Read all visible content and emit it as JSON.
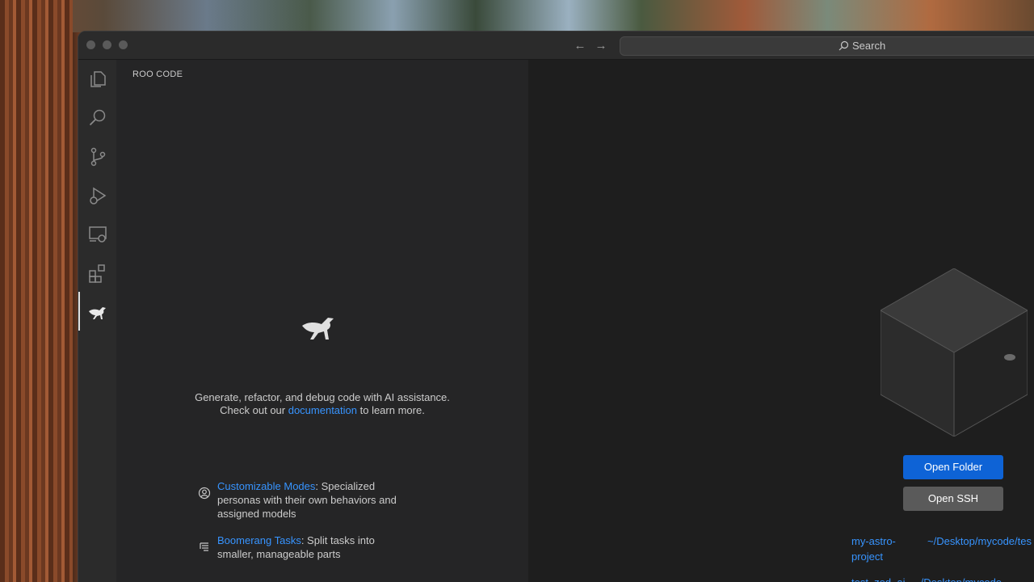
{
  "titlebar": {
    "search_placeholder": "Search"
  },
  "sidebar": {
    "title": "ROO CODE",
    "intro_line1": "Generate, refactor, and debug code with AI assistance.",
    "intro_prefix": "Check out our ",
    "intro_link": "documentation",
    "intro_suffix": " to learn more.",
    "features": [
      {
        "link": "Customizable Modes",
        "text": ": Specialized personas with their own behaviors and assigned models"
      },
      {
        "link": "Boomerang Tasks",
        "text": ": Split tasks into smaller, manageable parts"
      }
    ]
  },
  "editor": {
    "open_folder": "Open Folder",
    "open_ssh": "Open SSH",
    "recent": [
      {
        "name": "my-astro-project",
        "path": "~/Desktop/mycode/tes"
      },
      {
        "name": "test_zed_ai",
        "path": "~/Desktop/mycode"
      }
    ]
  },
  "colors": {
    "accent": "#3794ff",
    "primary_button": "#0e63d6",
    "sidebar_bg": "#252526",
    "editor_bg": "#1e1e1e"
  }
}
